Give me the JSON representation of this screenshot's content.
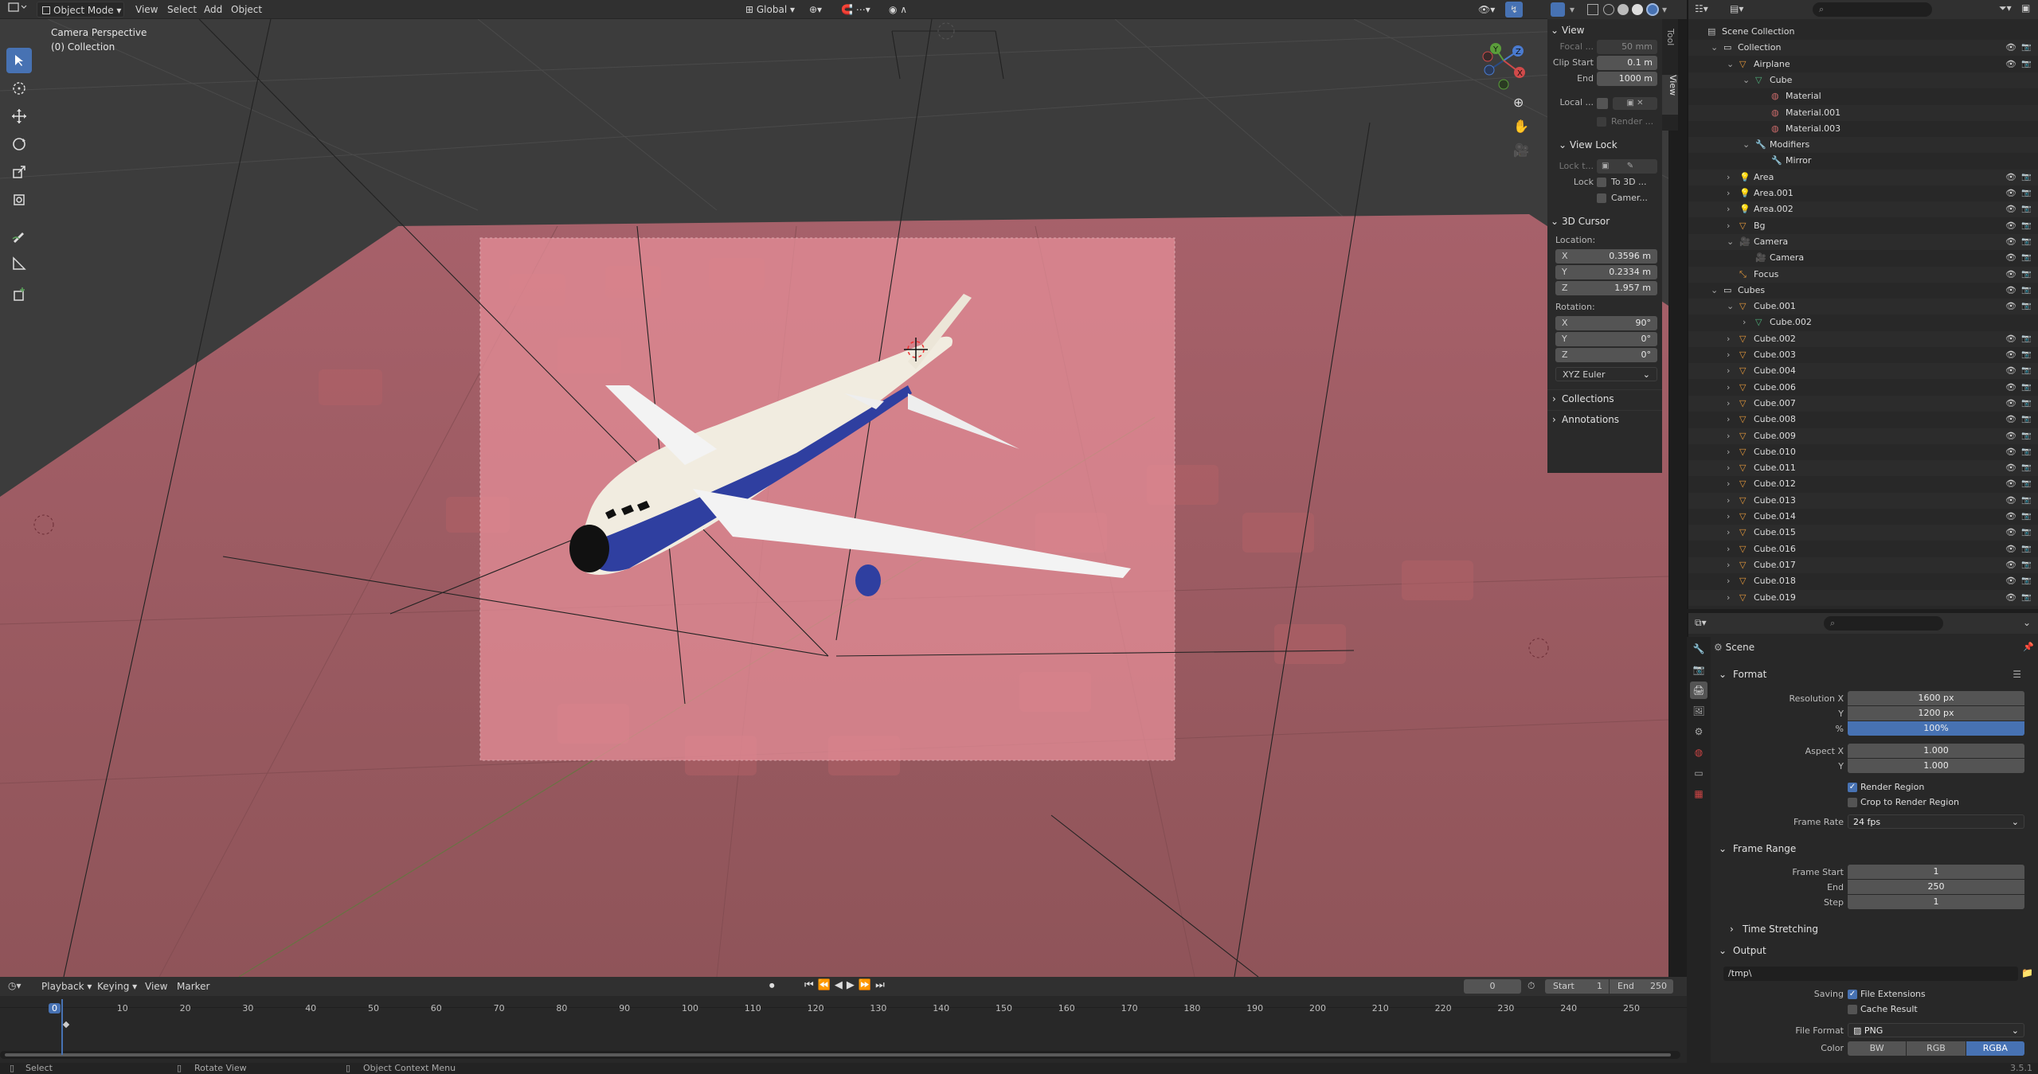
{
  "header": {
    "mode": "Object Mode",
    "menus": [
      "View",
      "Select",
      "Add",
      "Object"
    ],
    "orientation": "Global"
  },
  "viewport": {
    "camera_label": "Camera Perspective",
    "collection_label": "(0) Collection"
  },
  "npanel": {
    "tabs": [
      "Tool",
      "View"
    ],
    "view_header": "View",
    "focal_label": "Focal ...",
    "focal_value": "50 mm",
    "clip_start_label": "Clip Start",
    "clip_start_value": "0.1 m",
    "clip_end_label": "End",
    "clip_end_value": "1000 m",
    "local_label": "Local ...",
    "render_label": "Render ...",
    "view_lock_header": "View Lock",
    "lock_to_label": "Lock t...",
    "lock_label": "Lock",
    "lock_3d": "To 3D ...",
    "lock_camera": "Camer...",
    "cursor_header": "3D Cursor",
    "location_label": "Location:",
    "loc": [
      {
        "k": "X",
        "v": "0.3596 m"
      },
      {
        "k": "Y",
        "v": "0.2334 m"
      },
      {
        "k": "Z",
        "v": "1.957 m"
      }
    ],
    "rotation_label": "Rotation:",
    "rot": [
      {
        "k": "X",
        "v": "90°"
      },
      {
        "k": "Y",
        "v": "0°"
      },
      {
        "k": "Z",
        "v": "0°"
      }
    ],
    "rotation_mode": "XYZ Euler",
    "collections_header": "Collections",
    "annotations_header": "Annotations"
  },
  "outliner": {
    "rows": [
      {
        "label": "Scene Collection",
        "kind": "scene"
      },
      {
        "label": "Collection",
        "kind": "collection"
      },
      {
        "label": "Airplane",
        "kind": "object"
      },
      {
        "label": "Cube",
        "kind": "mesh"
      },
      {
        "label": "Material",
        "kind": "material"
      },
      {
        "label": "Material.001",
        "kind": "material"
      },
      {
        "label": "Material.003",
        "kind": "material"
      },
      {
        "label": "Modifiers",
        "kind": "modifier"
      },
      {
        "label": "Mirror",
        "kind": "modifier"
      },
      {
        "label": "Area",
        "kind": "light"
      },
      {
        "label": "Area.001",
        "kind": "light"
      },
      {
        "label": "Area.002",
        "kind": "light"
      },
      {
        "label": "Bg",
        "kind": "object"
      },
      {
        "label": "Camera",
        "kind": "camera"
      },
      {
        "label": "Camera",
        "kind": "camera"
      },
      {
        "label": "Focus",
        "kind": "empty"
      },
      {
        "label": "Cubes",
        "kind": "collection"
      },
      {
        "label": "Cube.001",
        "kind": "object"
      },
      {
        "label": "Cube.002",
        "kind": "mesh"
      },
      {
        "label": "Cube.002",
        "kind": "object"
      },
      {
        "label": "Cube.003",
        "kind": "object"
      },
      {
        "label": "Cube.004",
        "kind": "object"
      },
      {
        "label": "Cube.006",
        "kind": "object"
      },
      {
        "label": "Cube.007",
        "kind": "object"
      },
      {
        "label": "Cube.008",
        "kind": "object"
      },
      {
        "label": "Cube.009",
        "kind": "object"
      },
      {
        "label": "Cube.010",
        "kind": "object"
      },
      {
        "label": "Cube.011",
        "kind": "object"
      },
      {
        "label": "Cube.012",
        "kind": "object"
      },
      {
        "label": "Cube.013",
        "kind": "object"
      },
      {
        "label": "Cube.014",
        "kind": "object"
      },
      {
        "label": "Cube.015",
        "kind": "object"
      },
      {
        "label": "Cube.016",
        "kind": "object"
      },
      {
        "label": "Cube.017",
        "kind": "object"
      },
      {
        "label": "Cube.018",
        "kind": "object"
      },
      {
        "label": "Cube.019",
        "kind": "object"
      }
    ]
  },
  "properties": {
    "scene_label": "Scene",
    "format_header": "Format",
    "res_x_label": "Resolution X",
    "res_x": "1600 px",
    "res_y_label": "Y",
    "res_y": "1200 px",
    "res_pct_label": "%",
    "res_pct": "100%",
    "aspect_x_label": "Aspect X",
    "aspect_x": "1.000",
    "aspect_y_label": "Y",
    "aspect_y": "1.000",
    "render_region": "Render Region",
    "crop_region": "Crop to Render Region",
    "frame_rate_label": "Frame Rate",
    "frame_rate": "24 fps",
    "frame_range_header": "Frame Range",
    "frame_start_label": "Frame Start",
    "frame_start": "1",
    "end_label": "End",
    "end": "250",
    "step_label": "Step",
    "step": "1",
    "time_stretching": "Time Stretching",
    "output_header": "Output",
    "output_path": "/tmp\\",
    "saving_label": "Saving",
    "file_ext": "File Extensions",
    "cache_result": "Cache Result",
    "file_format_label": "File Format",
    "file_format": "PNG",
    "color_label": "Color",
    "color_opts": [
      "BW",
      "RGB",
      "RGBA"
    ],
    "version": "3.5.1"
  },
  "timeline": {
    "menus": [
      "Playback",
      "Keying",
      "View",
      "Marker"
    ],
    "current_frame": "0",
    "start_label": "Start",
    "start": "1",
    "end_label": "End",
    "end": "250",
    "ticks": [
      "0",
      "10",
      "20",
      "30",
      "40",
      "50",
      "60",
      "70",
      "80",
      "90",
      "100",
      "110",
      "120",
      "130",
      "140",
      "150",
      "160",
      "170",
      "180",
      "190",
      "200",
      "210",
      "220",
      "230",
      "240",
      "250"
    ]
  },
  "status": {
    "select": "Select",
    "rotate": "Rotate View",
    "context": "Object Context Menu"
  },
  "colors": {
    "accent": "#4772b3",
    "viewport_bg": "#3c3c3c",
    "ground": "#9a5a60",
    "camera_frame": "#e08a92"
  }
}
